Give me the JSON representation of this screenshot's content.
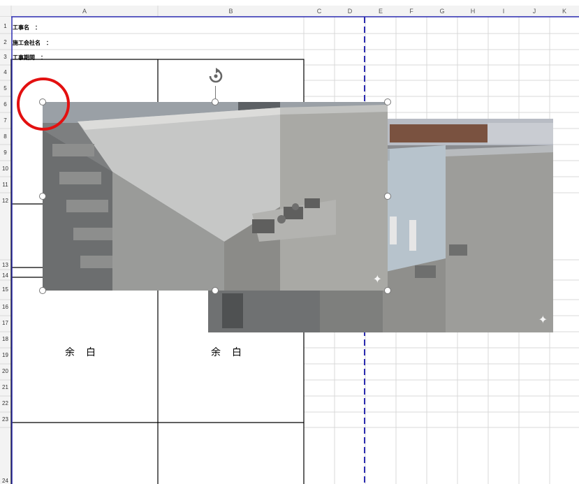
{
  "columns": [
    "A",
    "B",
    "C",
    "D",
    "E",
    "F",
    "G",
    "H",
    "I",
    "J",
    "K"
  ],
  "rows": [
    "1",
    "2",
    "3",
    "4",
    "5",
    "6",
    "7",
    "8",
    "9",
    "10",
    "11",
    "12",
    "13",
    "14",
    "15",
    "16",
    "17",
    "18",
    "19",
    "20",
    "21",
    "22",
    "23",
    "24"
  ],
  "cells": {
    "project_name_label": "工事名　：",
    "contractor_label": "施工会社名　：",
    "period_label": "工事期間　："
  },
  "blank_labels": [
    "余　白",
    "余　白"
  ],
  "colors": {
    "gridline": "#d9d9d9",
    "border": "#000000",
    "page_break": "#2b2bb0",
    "selection_ring": "#e31010"
  },
  "icons": [
    "rotate-handle-icon",
    "sparkle-icon"
  ]
}
